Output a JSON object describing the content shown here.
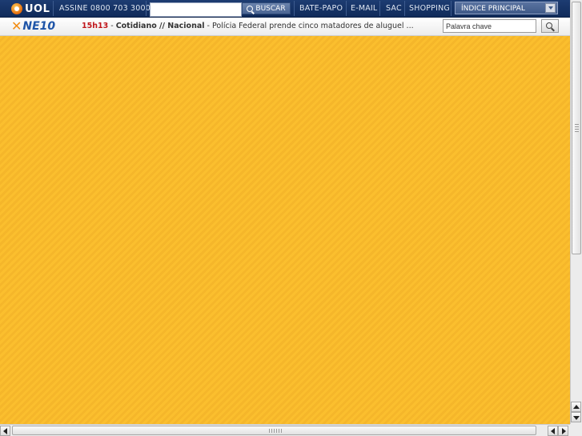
{
  "uol_bar": {
    "logo": "UOL",
    "assine": "ASSINE 0800 703 3000",
    "search_value": "",
    "buscar_label": "BUSCAR",
    "links": [
      "BATE-PAPO",
      "E-MAIL",
      "SAC",
      "SHOPPING"
    ],
    "indice_label": "ÍNDICE PRINCIPAL"
  },
  "ne_bar": {
    "logo": "NE10",
    "news_time": "15h13",
    "news_sep1": " - ",
    "news_category": "Cotidiano // Nacional",
    "news_sep2": " - ",
    "news_headline": "Polícia Federal prende cinco matadores de aluguel ...",
    "keyword_value": "Palavra chave"
  },
  "colors": {
    "uol_bar_bg": "#1a3668",
    "content_bg": "#fbbf2e",
    "news_time": "#c0161b",
    "ne10_blue": "#1f55a8",
    "ne10_orange": "#f28c12"
  },
  "icons": {
    "uol_logo": "uol-ball-logo",
    "buscar": "magnifier-icon",
    "indice_dropdown": "dropdown-arrow-icon",
    "keyword_search": "magnifier-icon"
  }
}
